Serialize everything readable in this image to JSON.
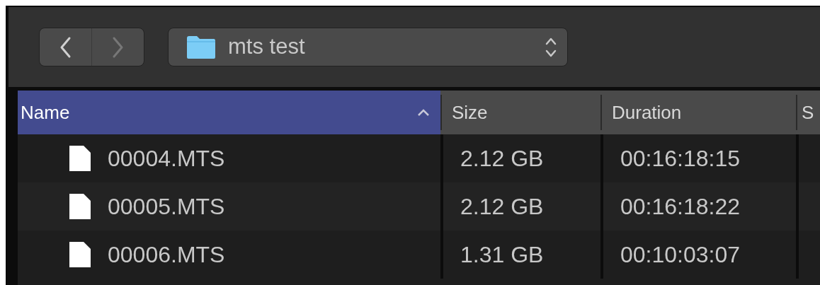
{
  "toolbar": {
    "nav_buttons": [
      {
        "kind": "back",
        "disabled": false
      },
      {
        "kind": "forward",
        "disabled": true
      }
    ],
    "path_popup": {
      "label": "mts test"
    }
  },
  "table": {
    "columns": [
      {
        "label": "Name",
        "selected": true
      },
      {
        "label": "Size",
        "selected": false
      },
      {
        "label": "Duration",
        "selected": false
      },
      {
        "label": "S",
        "selected": false
      }
    ],
    "rows": [
      {
        "name": "00004.MTS",
        "size": "2.12 GB",
        "duration": "00:16:18:15"
      },
      {
        "name": "00005.MTS",
        "size": "2.12 GB",
        "duration": "00:16:18:22"
      },
      {
        "name": "00006.MTS",
        "size": "1.31 GB",
        "duration": "00:10:03:07"
      }
    ]
  }
}
